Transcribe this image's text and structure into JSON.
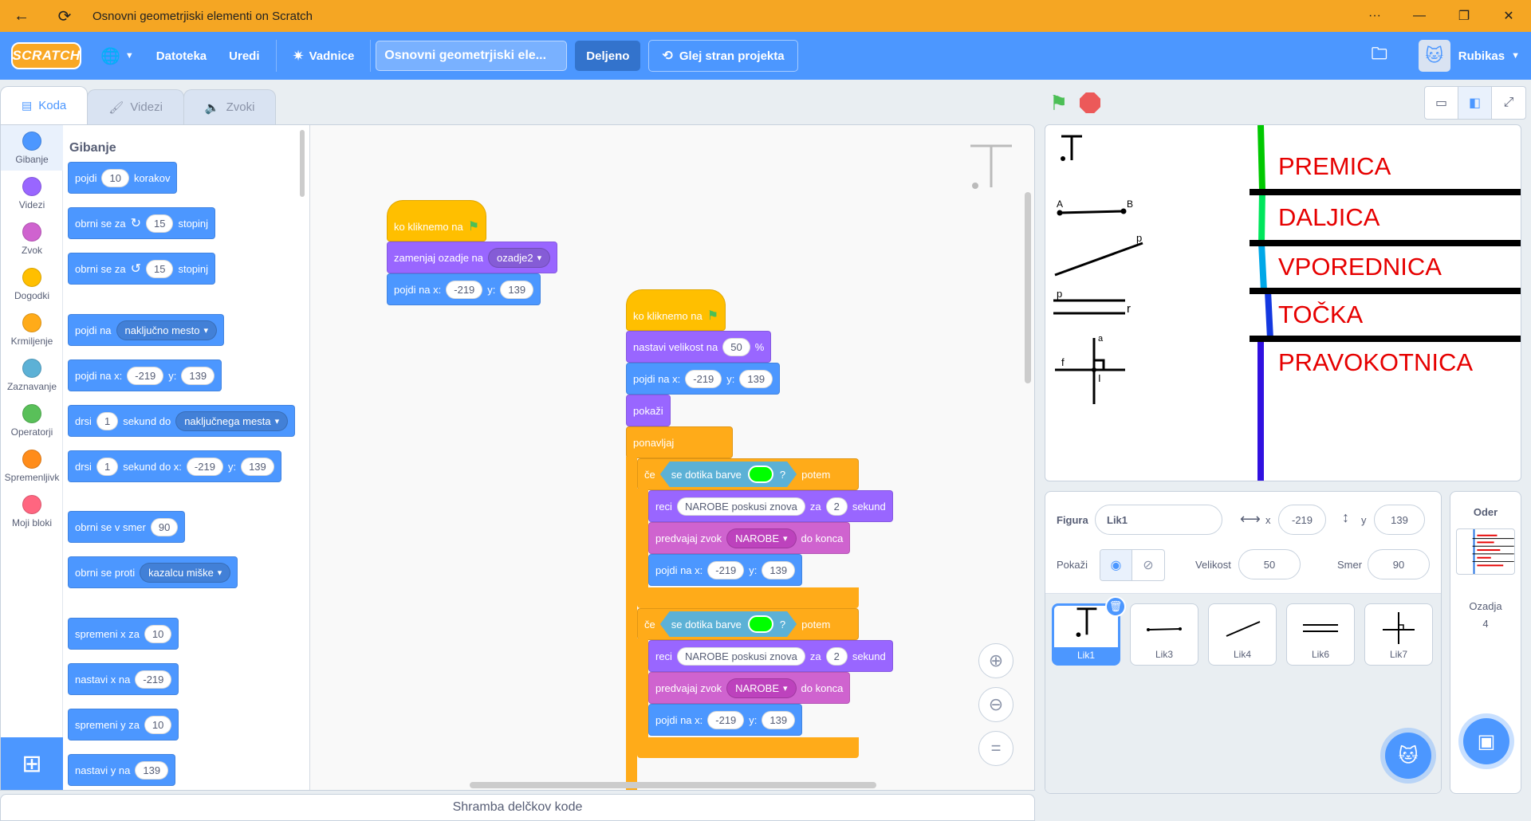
{
  "window": {
    "title": "Osnovni geometrjiski elementi on Scratch",
    "more": "···",
    "minimize": "—",
    "maximize": "❐",
    "close": "✕",
    "back": "←",
    "refresh": "⟳"
  },
  "menubar": {
    "logo": "SCRATCH",
    "file": "Datoteka",
    "edit": "Uredi",
    "tutorials": "Vadnice",
    "project_title": "Osnovni geometrjiski ele...",
    "shared": "Deljeno",
    "see_project": "Glej stran projekta",
    "username": "Rubikas"
  },
  "tabs": {
    "code": "Koda",
    "costumes": "Videzi",
    "sounds": "Zvoki"
  },
  "categories": [
    {
      "label": "Gibanje",
      "color": "#4c97ff"
    },
    {
      "label": "Videzi",
      "color": "#9966ff"
    },
    {
      "label": "Zvok",
      "color": "#cf63cf"
    },
    {
      "label": "Dogodki",
      "color": "#ffbf00"
    },
    {
      "label": "Krmiljenje",
      "color": "#ffab19"
    },
    {
      "label": "Zaznavanje",
      "color": "#5cb1d6"
    },
    {
      "label": "Operatorji",
      "color": "#59c059"
    },
    {
      "label": "Spremenljivk",
      "color": "#ff8c1a"
    },
    {
      "label": "Moji bloki",
      "color": "#ff6680"
    }
  ],
  "palette": {
    "title": "Gibanje",
    "move": {
      "a": "pojdi",
      "n": "10",
      "b": "korakov"
    },
    "turn_right": {
      "a": "obrni se za",
      "n": "15",
      "b": "stopinj"
    },
    "turn_left": {
      "a": "obrni se za",
      "n": "15",
      "b": "stopinj"
    },
    "goto": {
      "a": "pojdi na",
      "d": "naključno mesto"
    },
    "goto_xy": {
      "a": "pojdi na x:",
      "x": "-219",
      "ylab": "y:",
      "y": "139"
    },
    "glide": {
      "a": "drsi",
      "n": "1",
      "b": "sekund do",
      "d": "naključnega mesta"
    },
    "glide_xy": {
      "a": "drsi",
      "n": "1",
      "b": "sekund do x:",
      "x": "-219",
      "ylab": "y:",
      "y": "139"
    },
    "point_dir": {
      "a": "obrni se v smer",
      "n": "90"
    },
    "point_towards": {
      "a": "obrni se proti",
      "d": "kazalcu miške"
    },
    "change_x": {
      "a": "spremeni x za",
      "n": "10"
    },
    "set_x": {
      "a": "nastavi x na",
      "n": "-219"
    },
    "change_y": {
      "a": "spremeni y za",
      "n": "10"
    },
    "set_y": {
      "a": "nastavi y na",
      "n": "139"
    }
  },
  "script1": {
    "hat": "ko kliknemo na",
    "backdrop": {
      "a": "zamenjaj ozadje na",
      "d": "ozadje2"
    },
    "goto": {
      "a": "pojdi na x:",
      "x": "-219",
      "ylab": "y:",
      "y": "139"
    }
  },
  "script2": {
    "hat": "ko kliknemo na",
    "size": {
      "a": "nastavi velikost na",
      "n": "50",
      "b": "%"
    },
    "goto": {
      "a": "pojdi na x:",
      "x": "-219",
      "ylab": "y:",
      "y": "139"
    },
    "show": "pokaži",
    "forever": "ponavljaj",
    "if1": {
      "a": "če",
      "sense": "se dotika barve",
      "q": "?",
      "b": "potem"
    },
    "say1": {
      "a": "reci",
      "t": "NAROBE poskusi znova",
      "b": "za",
      "n": "2",
      "c": "sekund"
    },
    "sound1": {
      "a": "predvajaj zvok",
      "d": "NAROBE",
      "b": "do konca"
    },
    "goto1": {
      "a": "pojdi na x:",
      "x": "-219",
      "ylab": "y:",
      "y": "139"
    },
    "if2": {
      "a": "če",
      "sense": "se dotika barve",
      "q": "?",
      "b": "potem"
    },
    "say2": {
      "a": "reci",
      "t": "NAROBE poskusi znova",
      "b": "za",
      "n": "2",
      "c": "sekund"
    },
    "sound2": {
      "a": "predvajaj zvok",
      "d": "NAROBE",
      "b": "do konca"
    },
    "goto2": {
      "a": "pojdi na x:",
      "x": "-219",
      "ylab": "y:",
      "y": "139"
    }
  },
  "backpack": "Shramba delčkov kode",
  "stage": {
    "labels": [
      "PREMICA",
      "DALJICA",
      "VPOREDNICA",
      "TOČKA",
      "PRAVOKOTNICA"
    ],
    "point_labels": {
      "a": "A",
      "b": "B",
      "p": "p",
      "p2": "p",
      "r": "r",
      "a2": "a",
      "f": "f",
      "i": "I"
    }
  },
  "sprite_info": {
    "sprite_label": "Figura",
    "sprite_name": "Lik1",
    "x_label": "x",
    "x": "-219",
    "y_label": "y",
    "y": "139",
    "show_label": "Pokaži",
    "size_label": "Velikost",
    "size": "50",
    "dir_label": "Smer",
    "direction": "90"
  },
  "sprites": [
    "Lik1",
    "Lik3",
    "Lik4",
    "Lik6",
    "Lik7"
  ],
  "backdrops": {
    "title": "Oder",
    "label": "Ozadja",
    "count": "4"
  }
}
